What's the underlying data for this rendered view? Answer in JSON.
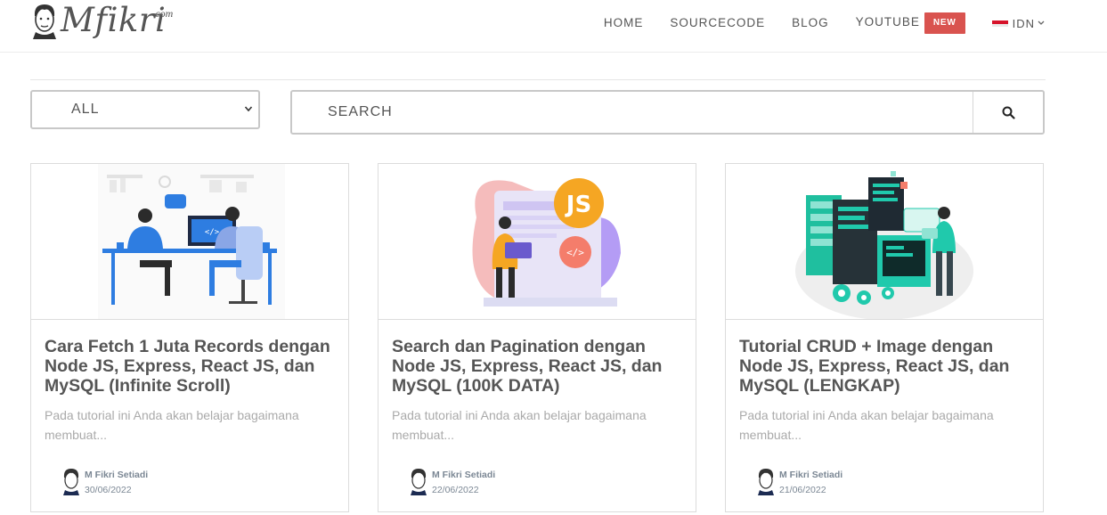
{
  "brand": {
    "name": "Mfikri",
    "suffix": "com"
  },
  "nav": {
    "items": [
      {
        "label": "HOME"
      },
      {
        "label": "SOURCECODE"
      },
      {
        "label": "BLOG"
      },
      {
        "label": "YOUTUBE"
      }
    ],
    "badge": "NEW",
    "language": "IDN"
  },
  "filter": {
    "category": "ALL",
    "search_placeholder": "SEARCH"
  },
  "posts": [
    {
      "title": "Cara Fetch 1 Juta Records dengan Node JS, Express, React JS, dan MySQL (Infinite Scroll)",
      "excerpt": "Pada tutorial ini Anda akan belajar bagaimana membuat...",
      "author": "M Fikri Setiadi",
      "date": "30/06/2022",
      "image": "developers-at-desk-illustration"
    },
    {
      "title": "Search dan Pagination dengan Node JS, Express, React JS, dan MySQL (100K DATA)",
      "excerpt": "Pada tutorial ini Anda akan belajar bagaimana membuat...",
      "author": "M Fikri Setiadi",
      "date": "22/06/2022",
      "image": "javascript-developer-illustration"
    },
    {
      "title": "Tutorial CRUD + Image dengan Node JS, Express, React JS, dan MySQL (LENGKAP)",
      "excerpt": "Pada tutorial ini Anda akan belajar bagaimana membuat...",
      "author": "M Fikri Setiadi",
      "date": "21/06/2022",
      "image": "server-monitors-illustration"
    }
  ],
  "colors": {
    "badge": "#d9534f",
    "text": "#555555",
    "muted": "#aaaaaa",
    "meta": "#7b8794",
    "teal": "#20c9ac",
    "blue": "#2e7de1",
    "purple": "#b49cf5",
    "orange": "#f5a623"
  }
}
